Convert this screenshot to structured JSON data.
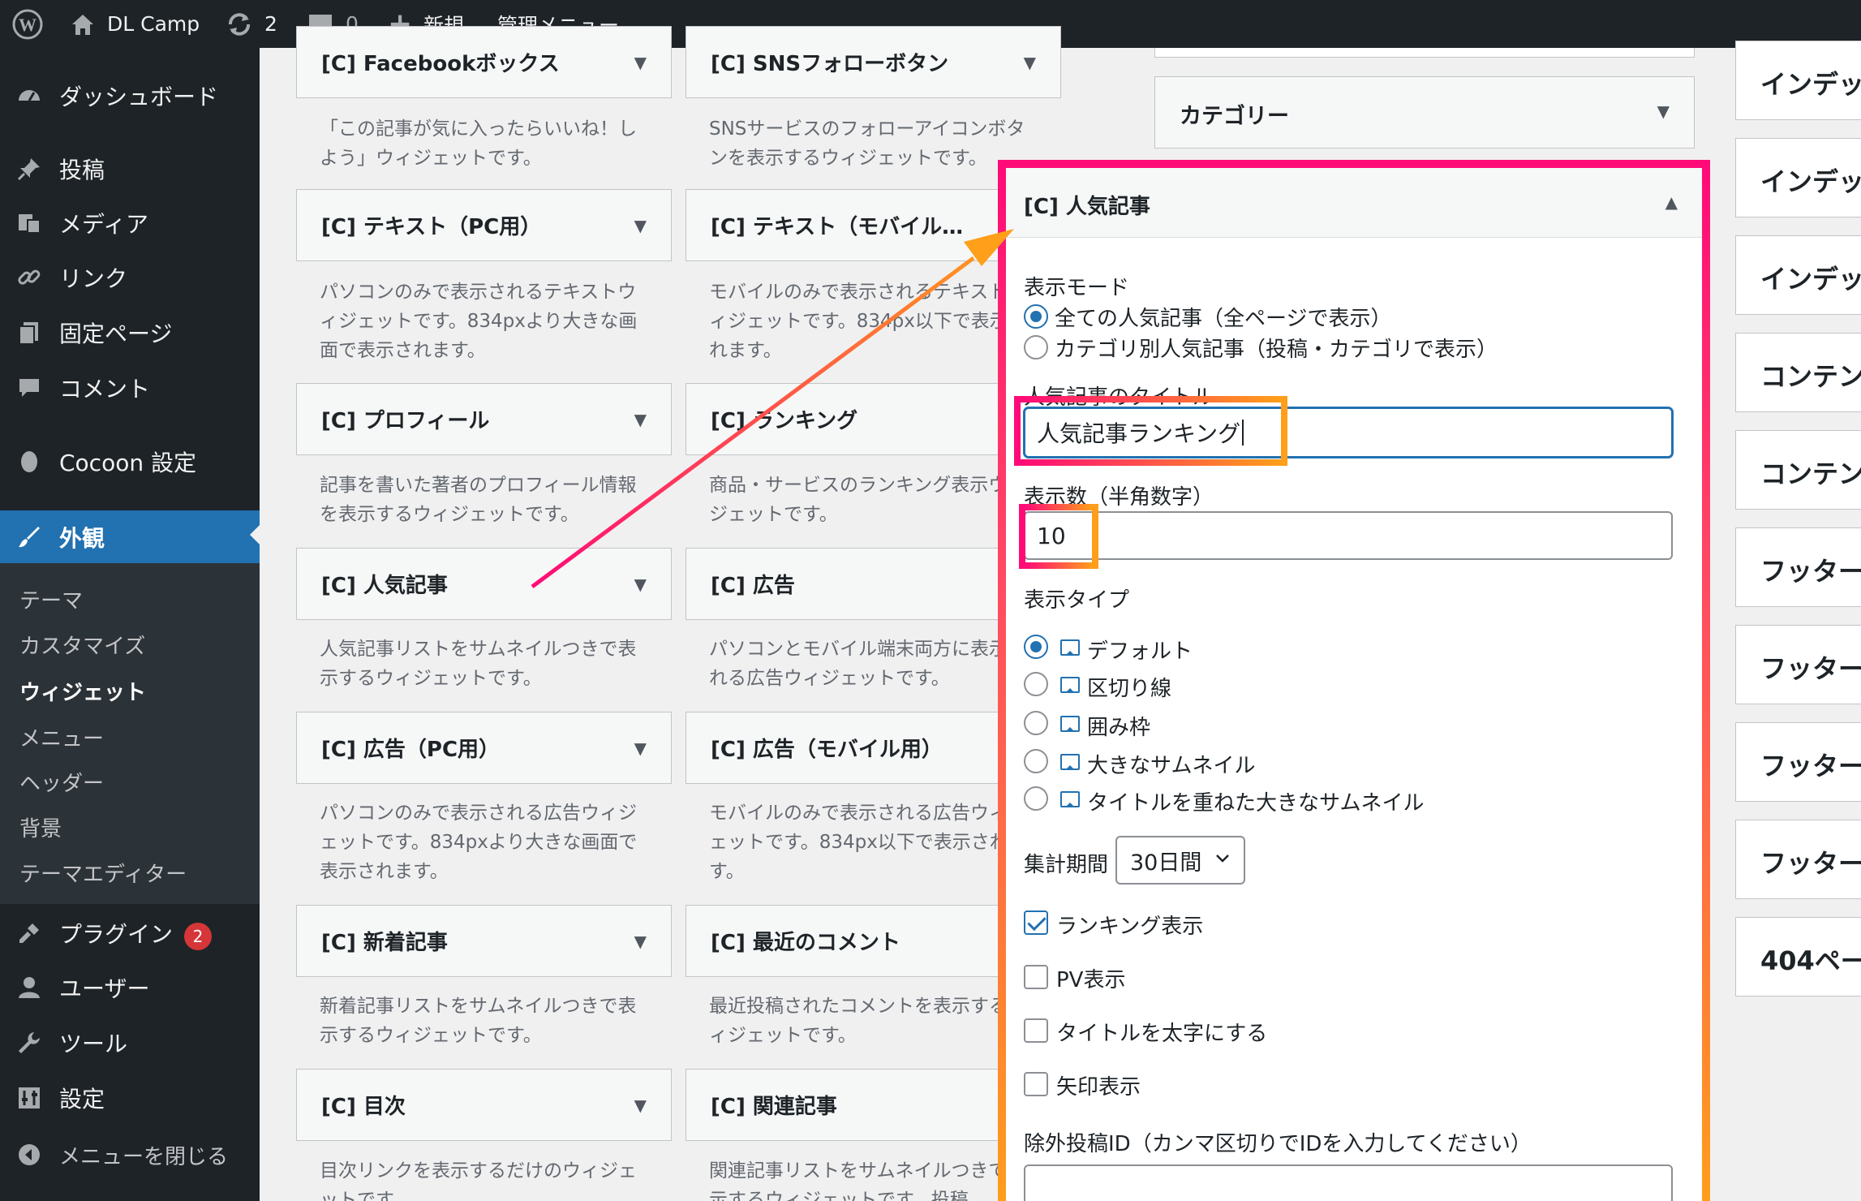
{
  "adminbar": {
    "site_name": "DL Camp",
    "updates_count": "2",
    "comments_count": "0",
    "new_label": "新規",
    "admin_menu_label": "管理メニュー"
  },
  "sidebar": {
    "items": [
      {
        "label": "ダッシュボード",
        "icon": "dashboard-icon"
      },
      {
        "label": "投稿",
        "icon": "pin-icon"
      },
      {
        "label": "メディア",
        "icon": "media-icon"
      },
      {
        "label": "リンク",
        "icon": "link-icon"
      },
      {
        "label": "固定ページ",
        "icon": "page-icon"
      },
      {
        "label": "コメント",
        "icon": "comment-icon"
      },
      {
        "label": "Cocoon 設定",
        "icon": "cocoon-icon"
      },
      {
        "label": "外観",
        "icon": "brush-icon"
      },
      {
        "label": "プラグイン",
        "icon": "plugin-icon",
        "badge": "2"
      },
      {
        "label": "ユーザー",
        "icon": "user-icon"
      },
      {
        "label": "ツール",
        "icon": "wrench-icon"
      },
      {
        "label": "設定",
        "icon": "settings-icon"
      },
      {
        "label": "メニューを閉じる",
        "icon": "collapse-icon"
      }
    ],
    "submenu": [
      "テーマ",
      "カスタマイズ",
      "ウィジェット",
      "メニュー",
      "ヘッダー",
      "背景",
      "テーマエディター"
    ]
  },
  "widgets": [
    {
      "title": "[C] Facebookボックス",
      "desc": "「この記事が気に入ったらいいね！しよう」ウィジェットです。"
    },
    {
      "title": "[C] SNSフォローボタン",
      "desc": "SNSサービスのフォローアイコンボタンを表示するウィジェットです。"
    },
    {
      "title": "[C] テキスト（PC用）",
      "desc": "パソコンのみで表示されるテキストウィジェットです。834pxより大きな画面で表示されます。"
    },
    {
      "title": "[C] テキスト（モバイル…",
      "desc": "モバイルのみで表示されるテキストウィジェットです。834px以下で表示されます。"
    },
    {
      "title": "[C] プロフィール",
      "desc": "記事を書いた著者のプロフィール情報を表示するウィジェットです。"
    },
    {
      "title": "[C] ランキング",
      "desc": "商品・サービスのランキング表示ウィジェットです。"
    },
    {
      "title": "[C] 人気記事",
      "desc": "人気記事リストをサムネイルつきで表示するウィジェットです。"
    },
    {
      "title": "[C] 広告",
      "desc": "パソコンとモバイル端末両方に表示される広告ウィジェットです。"
    },
    {
      "title": "[C] 広告（PC用）",
      "desc": "パソコンのみで表示される広告ウィジェットです。834pxより大きな画面で表示されます。"
    },
    {
      "title": "[C] 広告（モバイル用）",
      "desc": "モバイルのみで表示される広告ウィジェットです。834px以下で表示されます。"
    },
    {
      "title": "[C] 新着記事",
      "desc": "新着記事リストをサムネイルつきで表示するウィジェットです。"
    },
    {
      "title": "[C] 最近のコメント",
      "desc": "最近投稿されたコメントを表示するウィジェットです。"
    },
    {
      "title": "[C] 目次",
      "desc": "目次リンクを表示するだけのウィジェットです。"
    },
    {
      "title": "[C] 関連記事",
      "desc": "関連記事リストをサムネイルつきで表示するウィジェットです。投稿"
    }
  ],
  "sidebar_area": {
    "category_title": "カテゴリー"
  },
  "right_areas": [
    "インデッ",
    "インデッ",
    "インデッ",
    "コンテン",
    "コンテン",
    "フッター",
    "フッター",
    "フッター",
    "フッター",
    "404ペー"
  ],
  "popular_widget": {
    "title": "[C] 人気記事",
    "display_mode_label": "表示モード",
    "modes": [
      "全ての人気記事（全ページで表示）",
      "カテゴリ別人気記事（投稿・カテゴリで表示）"
    ],
    "selected_mode": 0,
    "title_label": "人気記事のタイトル",
    "title_value": "人気記事ランキング",
    "count_label": "表示数（半角数字）",
    "count_value": "10",
    "type_label": "表示タイプ",
    "types": [
      "デフォルト",
      "区切り線",
      "囲み枠",
      "大きなサムネイル",
      "タイトルを重ねた大きなサムネイル"
    ],
    "selected_type": 0,
    "period_label": "集計期間",
    "period_value": "30日間",
    "checkboxes": [
      {
        "label": "ランキング表示",
        "checked": true
      },
      {
        "label": "PV表示",
        "checked": false
      },
      {
        "label": "タイトルを太字にする",
        "checked": false
      },
      {
        "label": "矢印表示",
        "checked": false
      }
    ],
    "exclude_label": "除外投稿ID（カンマ区切りでIDを入力してください）"
  },
  "colors": {
    "admin_dark": "#1d2327",
    "accent_blue": "#2271b1",
    "highlight_pink": "#ff0a78",
    "highlight_orange": "#ff9f1a"
  }
}
